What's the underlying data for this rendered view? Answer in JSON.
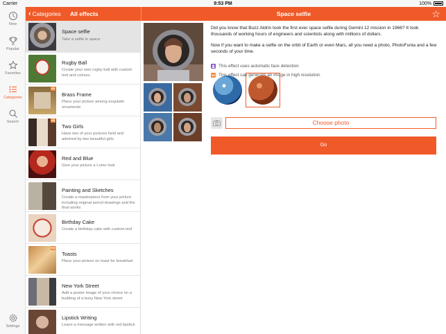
{
  "status": {
    "carrier": "Carrier",
    "time": "9:53 PM",
    "battery": "100%"
  },
  "tabs": [
    {
      "label": "New",
      "icon": "clock-icon"
    },
    {
      "label": "Popular",
      "icon": "trophy-icon"
    },
    {
      "label": "Favorites",
      "icon": "star-icon"
    },
    {
      "label": "Categories",
      "icon": "list-icon"
    },
    {
      "label": "Search",
      "icon": "search-icon"
    },
    {
      "label": "Settings",
      "icon": "gear-icon"
    }
  ],
  "header": {
    "back_label": "Categories",
    "list_title": "All effects",
    "detail_title": "Space selfie"
  },
  "colors": {
    "accent": "#f05a28"
  },
  "effects": [
    {
      "title": "Space selfie",
      "desc": "Take a selfie in space"
    },
    {
      "title": "Rugby Ball",
      "desc": "Create your own rugby ball with custom text and colours"
    },
    {
      "title": "Brass Frame",
      "desc": "Place your picture among exquisite ornaments"
    },
    {
      "title": "Two Girls",
      "desc": "Have two of your pictures held and admired by two beautiful girls"
    },
    {
      "title": "Red and Blue",
      "desc": "Give your picture a Lomo look"
    },
    {
      "title": "Painting and Sketches",
      "desc": "Create a masterpiece from your picture including original pencil drawings and the final works"
    },
    {
      "title": "Birthday Cake",
      "desc": "Create a birthday cake with custom text"
    },
    {
      "title": "Toasts",
      "desc": "Place your picture on toast for breakfast"
    },
    {
      "title": "New York Street",
      "desc": "Add a poster image of your choice on a building of a busy New York street"
    },
    {
      "title": "Lipstick Writing",
      "desc": "Leave a message written with red lipstick"
    }
  ],
  "detail": {
    "para1": "Did you know that Buzz Aldrin took the first ever space selfie during Gemini 12 mission in 1966? It took thousands of working hours of engineers and scientists along with millions of dollars.",
    "para2": "Now if you want to make a selfie on the orbit of Earth or even Mars, all you need a photo, PhotoFunia and a few seconds of your time.",
    "feature_face": "This effect uses automatic face detection",
    "feature_hd": "This effect can generate an image in high resolution",
    "choose_label": "Choose photo",
    "go_label": "Go"
  }
}
